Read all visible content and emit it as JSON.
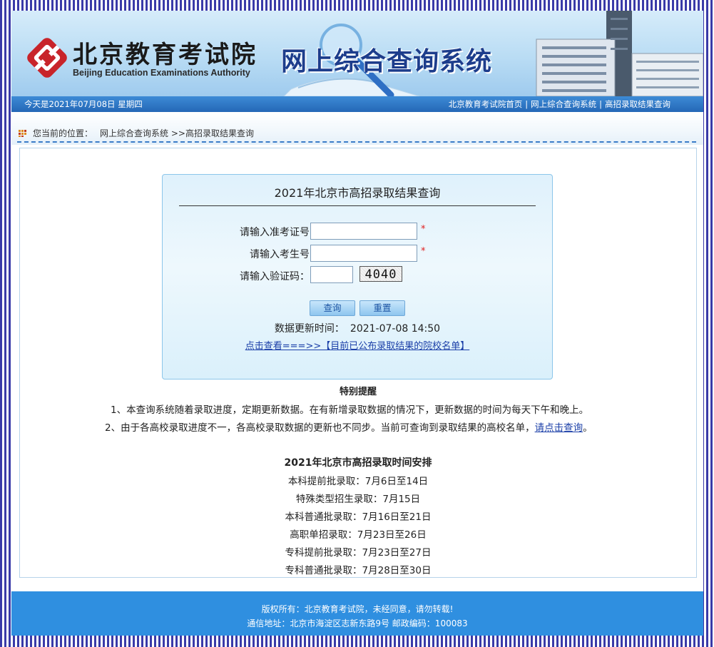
{
  "header": {
    "logo_cn": "北京教育考试院",
    "logo_en": "Beijing Education Examinations Authority",
    "system_title": "网上综合查询系统"
  },
  "navbar": {
    "date_text": "今天是2021年07月08日 星期四",
    "links": [
      "北京教育考试院首页",
      "网上综合查询系统",
      "高招录取结果查询"
    ],
    "separator": "|"
  },
  "breadcrumb": {
    "label": "您当前的位置：",
    "path": "网上综合查询系统 >>高招录取结果查询"
  },
  "query": {
    "title": "2021年北京市高招录取结果查询",
    "fields": [
      {
        "label": "请输入准考证号",
        "value": "",
        "required": "*"
      },
      {
        "label": "请输入考生号",
        "value": "",
        "required": "*"
      },
      {
        "label": "请输入验证码：",
        "value": ""
      }
    ],
    "captcha": "4040",
    "submit_label": "查询",
    "reset_label": "重置",
    "update_label": "数据更新时间：",
    "update_value": "2021-07-08 14:50",
    "school_list_link": "点击查看===>>【目前已公布录取结果的院校名单】"
  },
  "notice": {
    "title": "特别提醒",
    "line1": "1、本查询系统随着录取进度，定期更新数据。在有新增录取数据的情况下，更新数据的时间为每天下午和晚上。",
    "line2_text": "2、由于各高校录取进度不一，各高校录取数据的更新也不同步。当前可查询到录取结果的高校名单，",
    "line2_link": "请点击查询",
    "line2_end": "。"
  },
  "schedule": {
    "title": "2021年北京市高招录取时间安排",
    "items": [
      "本科提前批录取：7月6日至14日",
      "特殊类型招生录取：7月15日",
      "本科普通批录取：7月16日至21日",
      "高职单招录取：7月23日至26日",
      "专科提前批录取：7月23日至27日",
      "专科普通批录取：7月28日至30日"
    ]
  },
  "footer": {
    "copyright": "版权所有：北京教育考试院，未经同意，请勿转载!",
    "address": "通信地址：北京市海淀区志新东路9号 邮政编码：100083"
  },
  "colors": {
    "nav_bar": "#2467b6",
    "footer": "#2f8fe0",
    "logo_red": "#c8242a",
    "title_blue": "#1d3d8c",
    "required_red": "#e02020"
  }
}
